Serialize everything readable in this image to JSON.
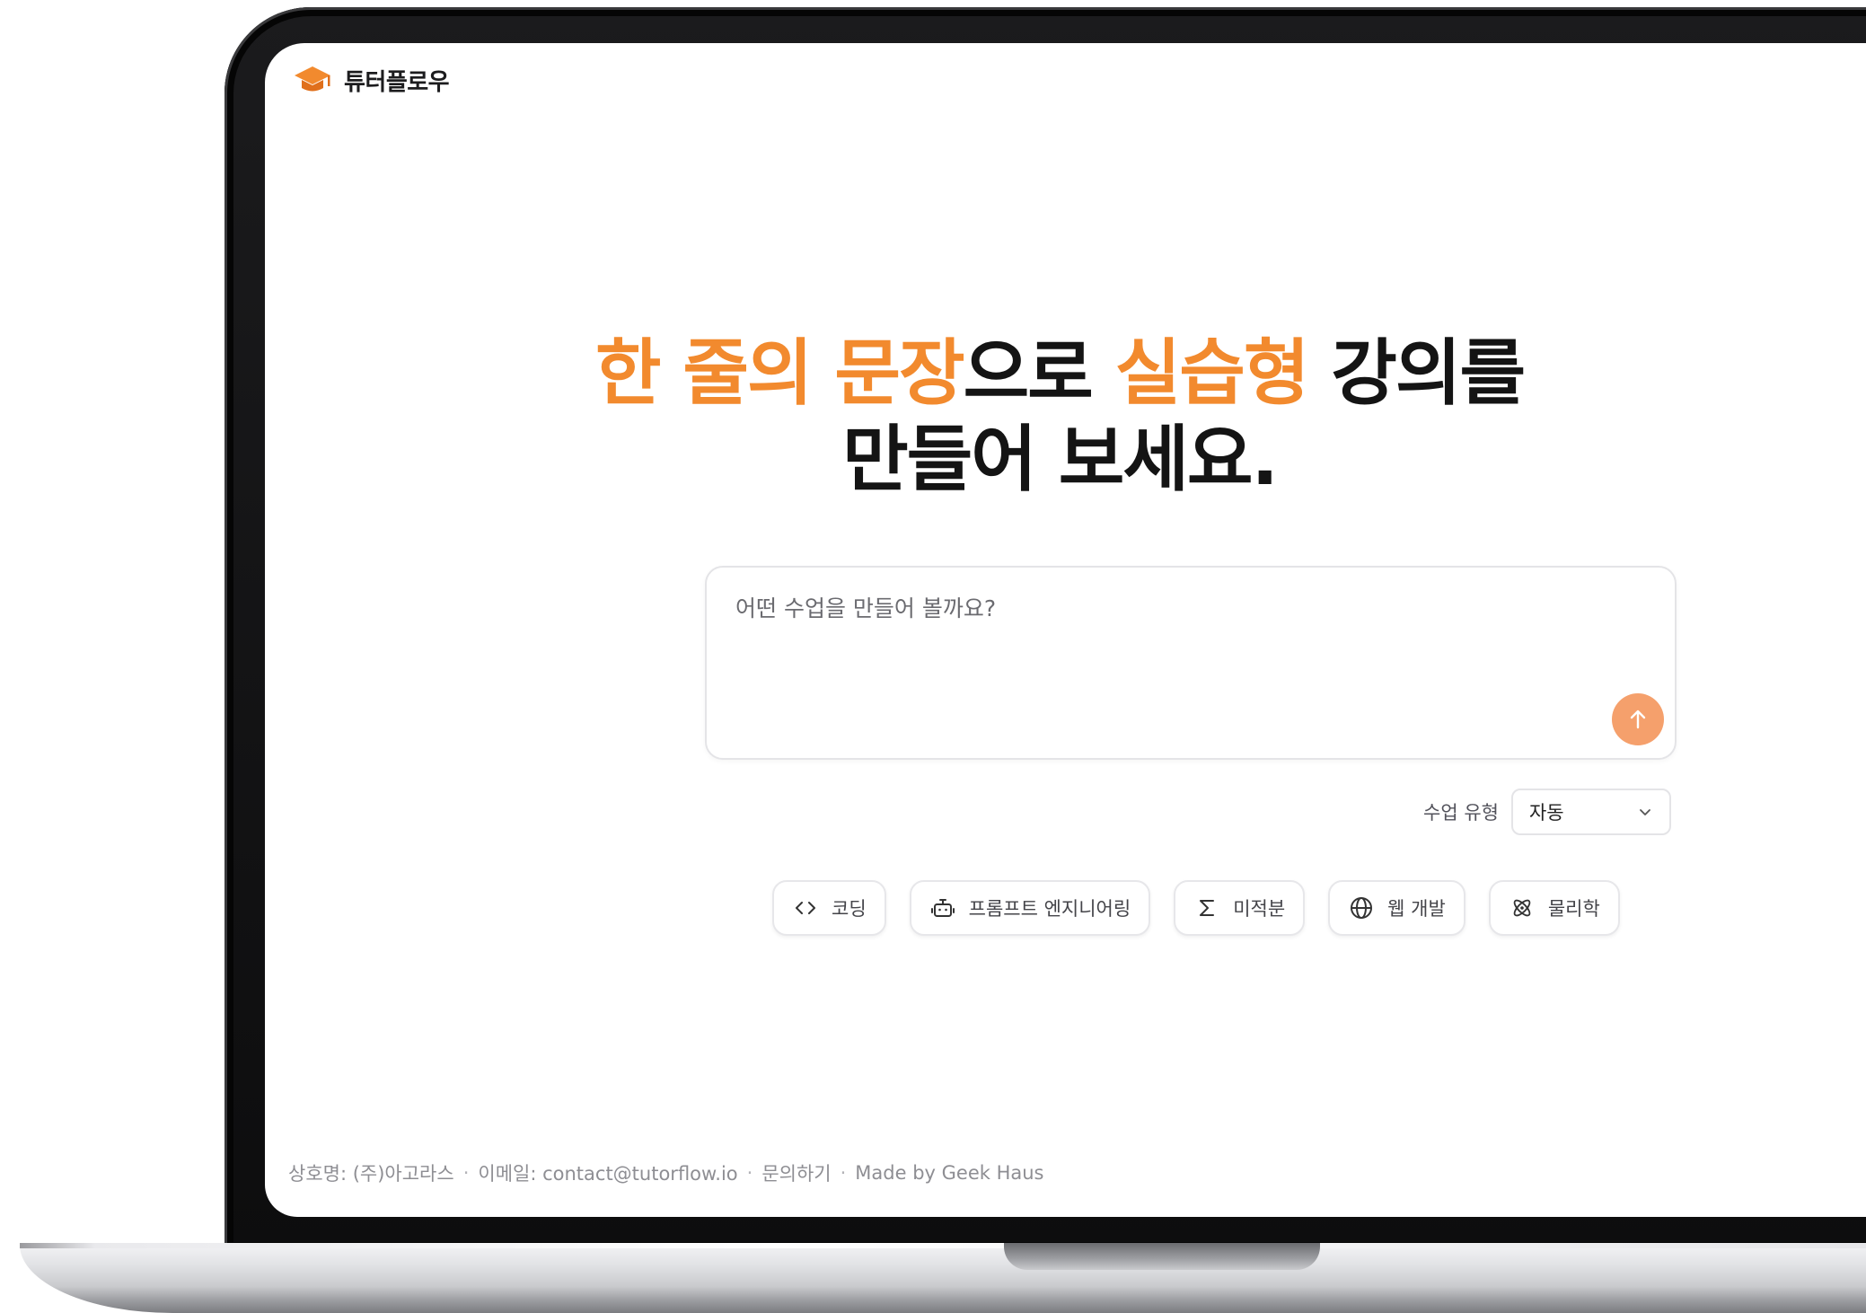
{
  "brand": {
    "name": "튜터플로우",
    "logo_icon": "graduation-cap-icon",
    "accent_color": "#f28a2e"
  },
  "hero": {
    "line1_part1": "한 줄의 문장",
    "line1_part2": "으로 ",
    "line1_part3": "실습형",
    "line1_part4": " 강의를",
    "line2": "만들어 보세요."
  },
  "prompt": {
    "placeholder": "어떤 수업을 만들어 볼까요?",
    "value": "",
    "send_icon": "arrow-up-icon",
    "send_color": "#f5a06c"
  },
  "lesson_type": {
    "label": "수업 유형",
    "selected": "자동",
    "icon": "chevron-down-icon"
  },
  "suggestions": [
    {
      "label": "코딩",
      "icon": "code-icon"
    },
    {
      "label": "프롬프트 엔지니어링",
      "icon": "robot-icon"
    },
    {
      "label": "미적분",
      "icon": "sigma-icon"
    },
    {
      "label": "웹 개발",
      "icon": "globe-icon"
    },
    {
      "label": "물리학",
      "icon": "atom-icon"
    }
  ],
  "footer": {
    "company": "상호명: (주)아고라스",
    "separator": "·",
    "email": "이메일: contact@tutorflow.io",
    "contact": "문의하기",
    "credit": "Made by Geek Haus"
  }
}
